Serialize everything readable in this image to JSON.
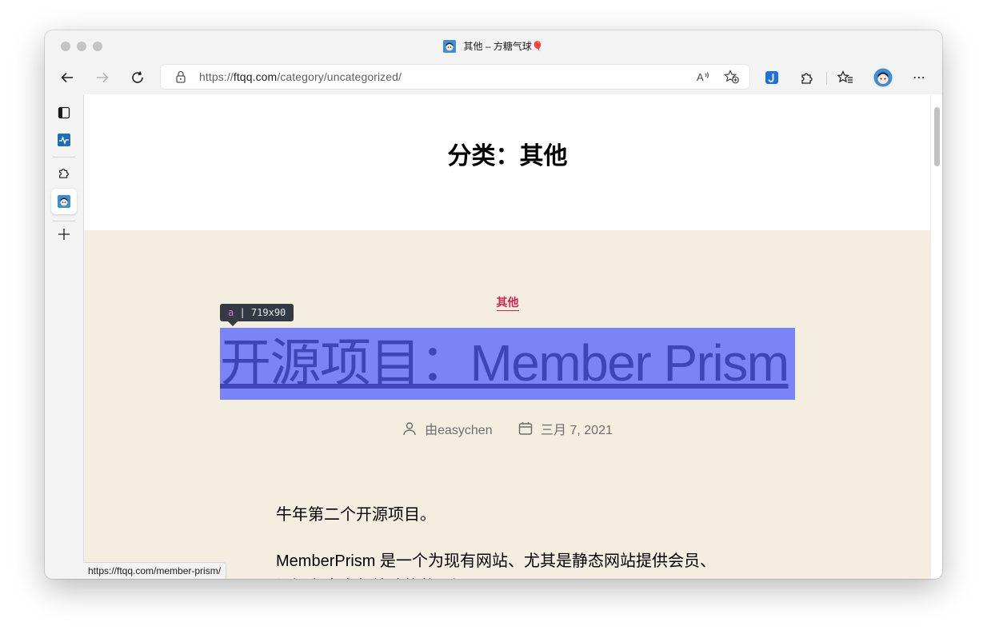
{
  "window": {
    "tab_title": "其他 – 方糖气球🎈"
  },
  "toolbar": {
    "url_prefix": "https://",
    "url_domain": "ftqq.com",
    "url_path": "/category/uncategorized/",
    "read_aloud_label": "A",
    "more_label": "⋯"
  },
  "page": {
    "title": "分类：其他",
    "post": {
      "category": "其他",
      "title": "开源项目：Member Prism",
      "author": "由easychen",
      "date": "三月 7, 2021",
      "paragraphs": [
        "牛年第二个开源项目。",
        "MemberPrism 是一个为现有网站、尤其是静态网站提供会员、订阅和内容保护功能的开源工具。"
      ]
    }
  },
  "inspector": {
    "tag": "a",
    "separator": " | ",
    "size": "719x90"
  },
  "status": {
    "hover_url": "https://ftqq.com/member-prism/"
  },
  "colors": {
    "accent": "#cd2653",
    "post_bg": "#f4eee0",
    "highlight": "#7882f6"
  }
}
